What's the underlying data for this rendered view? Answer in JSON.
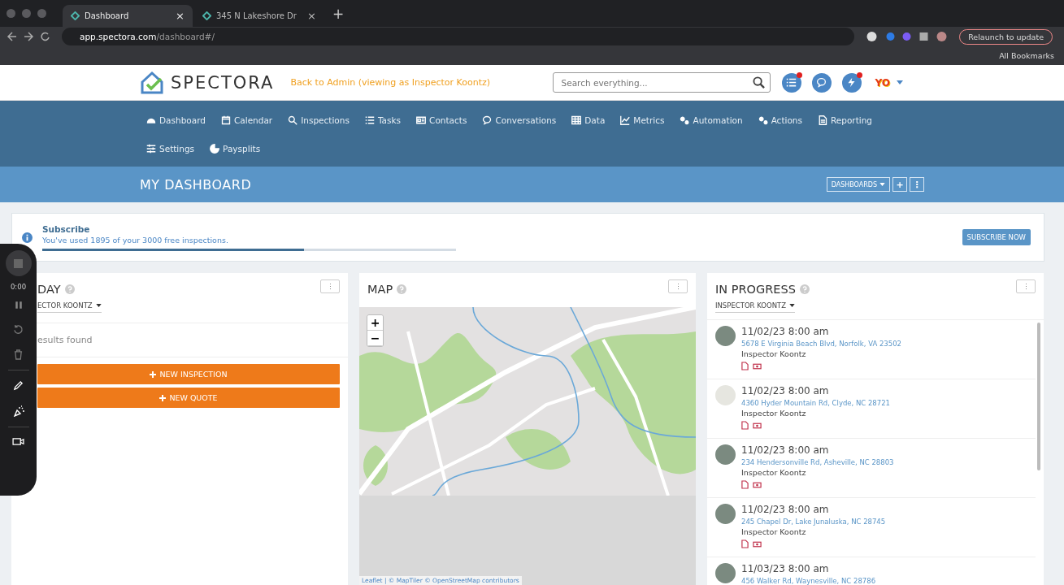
{
  "browser": {
    "tabs": [
      {
        "title": "Dashboard",
        "close": "×",
        "selected": true
      },
      {
        "title": "345 N Lakeshore Dr",
        "close": "×",
        "selected": false
      }
    ],
    "new_tab": "+",
    "url_host": "app.spectora.com",
    "url_path": "/dashboard#/",
    "relaunch": "Relaunch to update",
    "bookmarks": "All Bookmarks"
  },
  "header": {
    "brand": "SPECTORA",
    "back_link": "Back to Admin (viewing as Inspector Koontz)",
    "search": {
      "placeholder": "Search everything..."
    },
    "icons": [
      {
        "kind": "list",
        "badge": true
      },
      {
        "kind": "chat",
        "badge": false
      },
      {
        "kind": "bolt",
        "badge": true
      }
    ],
    "user_logo": "YO"
  },
  "nav": [
    {
      "label": "Dashboard"
    },
    {
      "label": "Calendar"
    },
    {
      "label": "Inspections"
    },
    {
      "label": "Tasks"
    },
    {
      "label": "Contacts"
    },
    {
      "label": "Conversations"
    },
    {
      "label": "Data"
    },
    {
      "label": "Metrics"
    },
    {
      "label": "Automation"
    },
    {
      "label": "Actions"
    },
    {
      "label": "Reporting"
    },
    {
      "label": "Settings"
    },
    {
      "label": "Paysplits"
    }
  ],
  "title_bar": {
    "title": "MY DASHBOARD",
    "dashboards": "DASHBOARDS",
    "add": "+",
    "more": "⋮"
  },
  "subscribe": {
    "title": "Subscribe",
    "text": "You've used 1895 of your 3000 free inspections.",
    "level": 0.633,
    "button": "SUBSCRIBE NOW"
  },
  "today": {
    "title": "DAY",
    "filter": "ECTOR KOONTZ",
    "empty": "esults found",
    "buttons": [
      "NEW INSPECTION",
      "NEW QUOTE"
    ],
    "more": "⋮"
  },
  "map": {
    "title": "MAP",
    "zoom_in": "+",
    "zoom_out": "−",
    "attribution": "Leaflet | © MapTiler © OpenStreetMap contributors",
    "more": "⋮"
  },
  "in_progress": {
    "title": "IN PROGRESS",
    "filter": "INSPECTOR KOONTZ",
    "more": "⋮",
    "items": [
      {
        "date": "11/02/23 8:00 am",
        "address": "5678 E Virginia Beach Blvd, Norfolk, VA 23502",
        "inspector": "Inspector Koontz",
        "photo": true
      },
      {
        "date": "11/02/23 8:00 am",
        "address": "4360 Hyder Mountain Rd, Clyde, NC 28721",
        "inspector": "Inspector Koontz",
        "photo": false
      },
      {
        "date": "11/02/23 8:00 am",
        "address": "234 Hendersonville Rd, Asheville, NC 28803",
        "inspector": "Inspector Koontz",
        "photo": true
      },
      {
        "date": "11/02/23 8:00 am",
        "address": "245 Chapel Dr, Lake Junaluska, NC 28745",
        "inspector": "Inspector Koontz",
        "photo": true
      },
      {
        "date": "11/03/23 8:00 am",
        "address": "456 Walker Rd, Waynesville, NC 28786",
        "photo": true
      }
    ]
  },
  "recorder": {
    "time": "0:00"
  }
}
